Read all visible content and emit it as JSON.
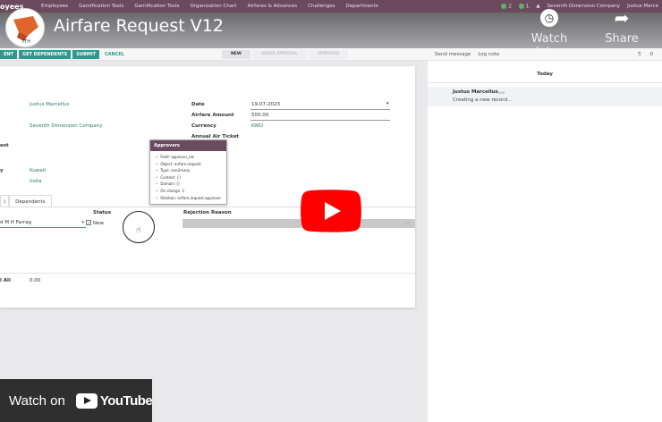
{
  "topnav": {
    "brand": "oyees",
    "menu": [
      "Employees",
      "Gamification Tools",
      "Gamification Tools",
      "Organization Chart",
      "Airfares & Advances",
      "Challenges",
      "Departments"
    ],
    "company": "Seventh Dimension Company",
    "user": "Justus Marce",
    "badge_1": "2",
    "badge_2": "1"
  },
  "breadcrumb": {
    "fragment_1": "re",
    "fragment_2": "o"
  },
  "video": {
    "title": "Airfare Request V12",
    "watch_later": "Watch later",
    "share": "Share",
    "watch_on": "Watch on",
    "youtube": "YouTube",
    "logo_text": "7TH",
    "play_color": "#ff0000"
  },
  "actions": {
    "buttons": [
      "ENT",
      "GET DEPENDENTS",
      "SUBMIT"
    ],
    "cancel": "CANCEL",
    "states": [
      "NEW",
      "UNDER APPROVAL",
      "APPROVED"
    ]
  },
  "chatter": {
    "send_message": "Send message",
    "log_note": "Log note",
    "attachments": "0",
    "today": "Today",
    "message": {
      "author": "Justus Marcellus",
      "when": "now",
      "body": "Creating a new record..."
    }
  },
  "form": {
    "employee_value": "Justus Marcellus",
    "company_value": "Seventh Dimension Company",
    "label_est": "est",
    "label_y": "y",
    "country_value": "Kuwait",
    "nationality_value": "India",
    "date_label": "Date",
    "date_value": "19-07-2023",
    "amount_label": "Airfare Amount",
    "amount_value": "500.00",
    "currency_label": "Currency",
    "currency_value": "KWD",
    "ticket_label": "Annual Air Ticket"
  },
  "tooltip": {
    "title": "Approvers",
    "items": [
      "Field: approver_ids",
      "Object: airfare.request",
      "Type: one2many",
      "Context: {}",
      "Domain: []",
      "On change: 1",
      "Relation: airfare.request.approver"
    ]
  },
  "notebook": {
    "tab_fragment": ")",
    "tab_dependents": "Dependents",
    "col_status": "Status",
    "col_rejection": "Rejection Reason",
    "row_name": "d M H Farrag",
    "row_status": "New",
    "total_label": "l All",
    "total_value": "0.00"
  }
}
